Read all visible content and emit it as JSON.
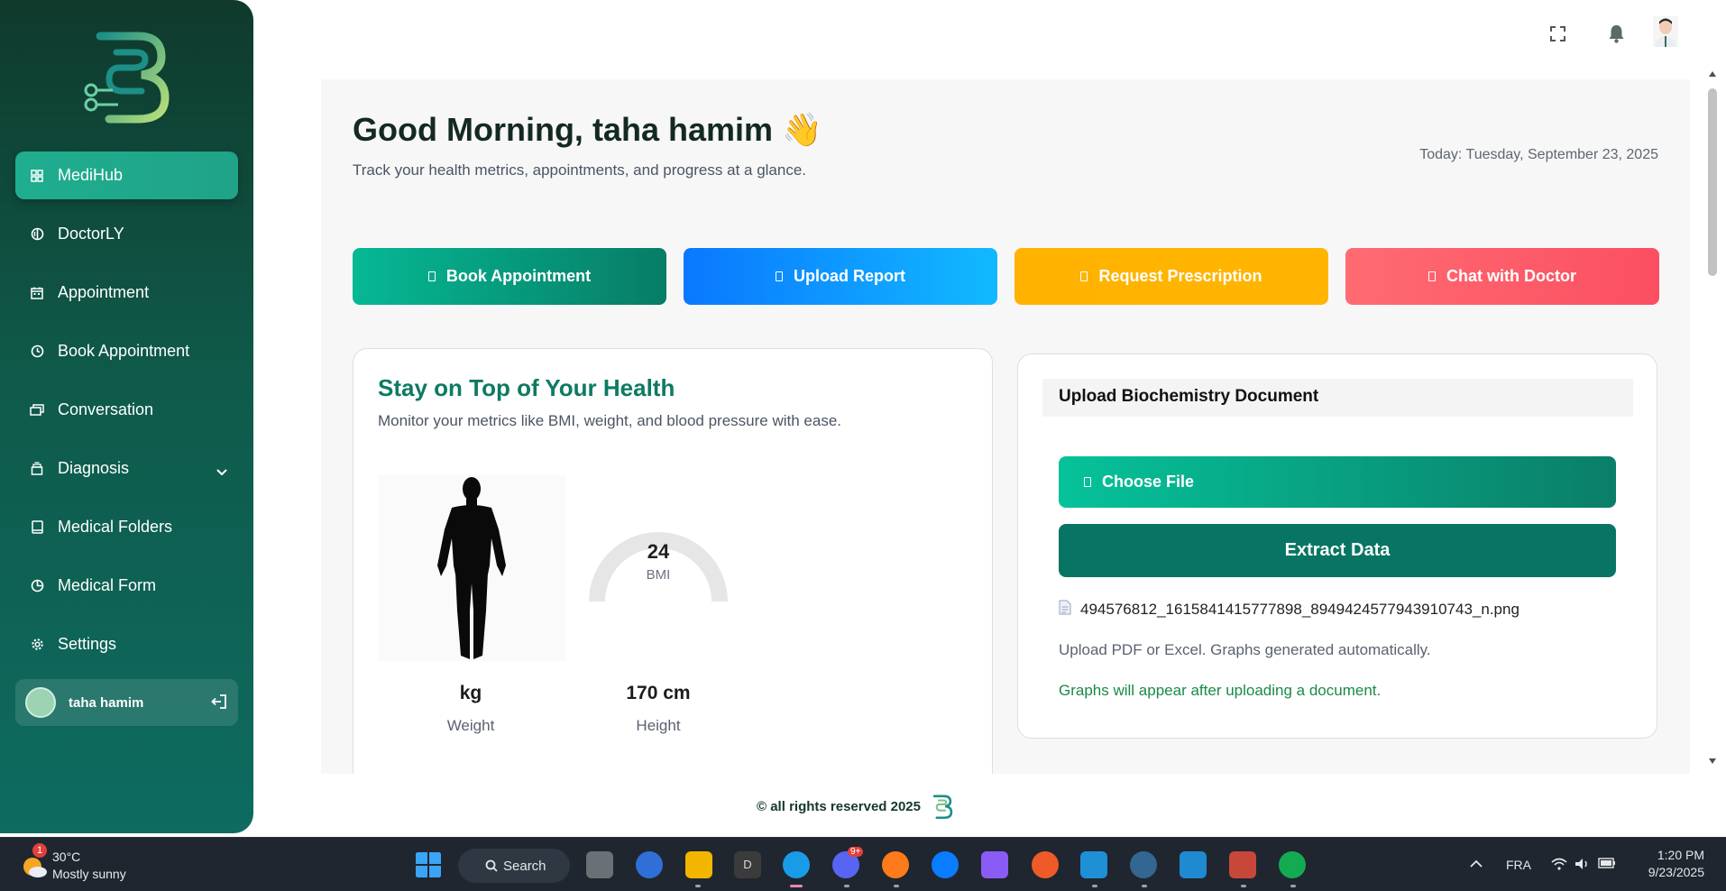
{
  "sidebar": {
    "items": [
      {
        "label": "MediHub",
        "icon": "grid-icon"
      },
      {
        "label": "DoctorLY",
        "icon": "circle-split-icon"
      },
      {
        "label": "Appointment",
        "icon": "calendar-icon"
      },
      {
        "label": "Book Appointment",
        "icon": "clock-icon"
      },
      {
        "label": "Conversation",
        "icon": "chat-icon"
      },
      {
        "label": "Diagnosis",
        "icon": "archive-icon"
      },
      {
        "label": "Medical Folders",
        "icon": "book-icon"
      },
      {
        "label": "Medical Form",
        "icon": "pie-icon"
      },
      {
        "label": "Settings",
        "icon": "gear-icon"
      }
    ],
    "user_name": "taha hamim"
  },
  "main": {
    "greeting": "Good Morning, taha hamim 👋",
    "subtitle": "Track your health metrics, appointments, and progress at a glance.",
    "today": "Today: Tuesday, September 23, 2025",
    "actions": [
      "Book Appointment",
      "Upload Report",
      "Request Prescription",
      "Chat with Doctor"
    ]
  },
  "health": {
    "title": "Stay on Top of Your Health",
    "subtitle": "Monitor your metrics like BMI, weight, and blood pressure with ease.",
    "bmi_value": "24",
    "bmi_label": "BMI",
    "weight_value": "kg",
    "weight_label": "Weight",
    "height_value": "170 cm",
    "height_label": "Height"
  },
  "upload": {
    "title": "Upload Biochemistry Document",
    "choose_label": "Choose File",
    "extract_label": "Extract Data",
    "filename": "494576812_1615841415777898_8949424577943910743_n.png",
    "hint": "Upload PDF or Excel. Graphs generated automatically.",
    "note": "Graphs will appear after uploading a document."
  },
  "footer": {
    "text": "© all rights reserved 2025"
  },
  "taskbar": {
    "weather_temp": "30°C",
    "weather_desc": "Mostly sunny",
    "weather_badge": "1",
    "search_label": "Search",
    "discord_badge": "9+",
    "lang": "FRA",
    "time": "1:20 PM",
    "date": "9/23/2025"
  },
  "colors": {
    "sidebar_top": "#0f3a2c",
    "sidebar_bottom": "#0d6b60",
    "accent_green": "#0e7a62",
    "blue": "#0a78ff",
    "amber": "#ffb300",
    "red": "#fb4f61"
  }
}
